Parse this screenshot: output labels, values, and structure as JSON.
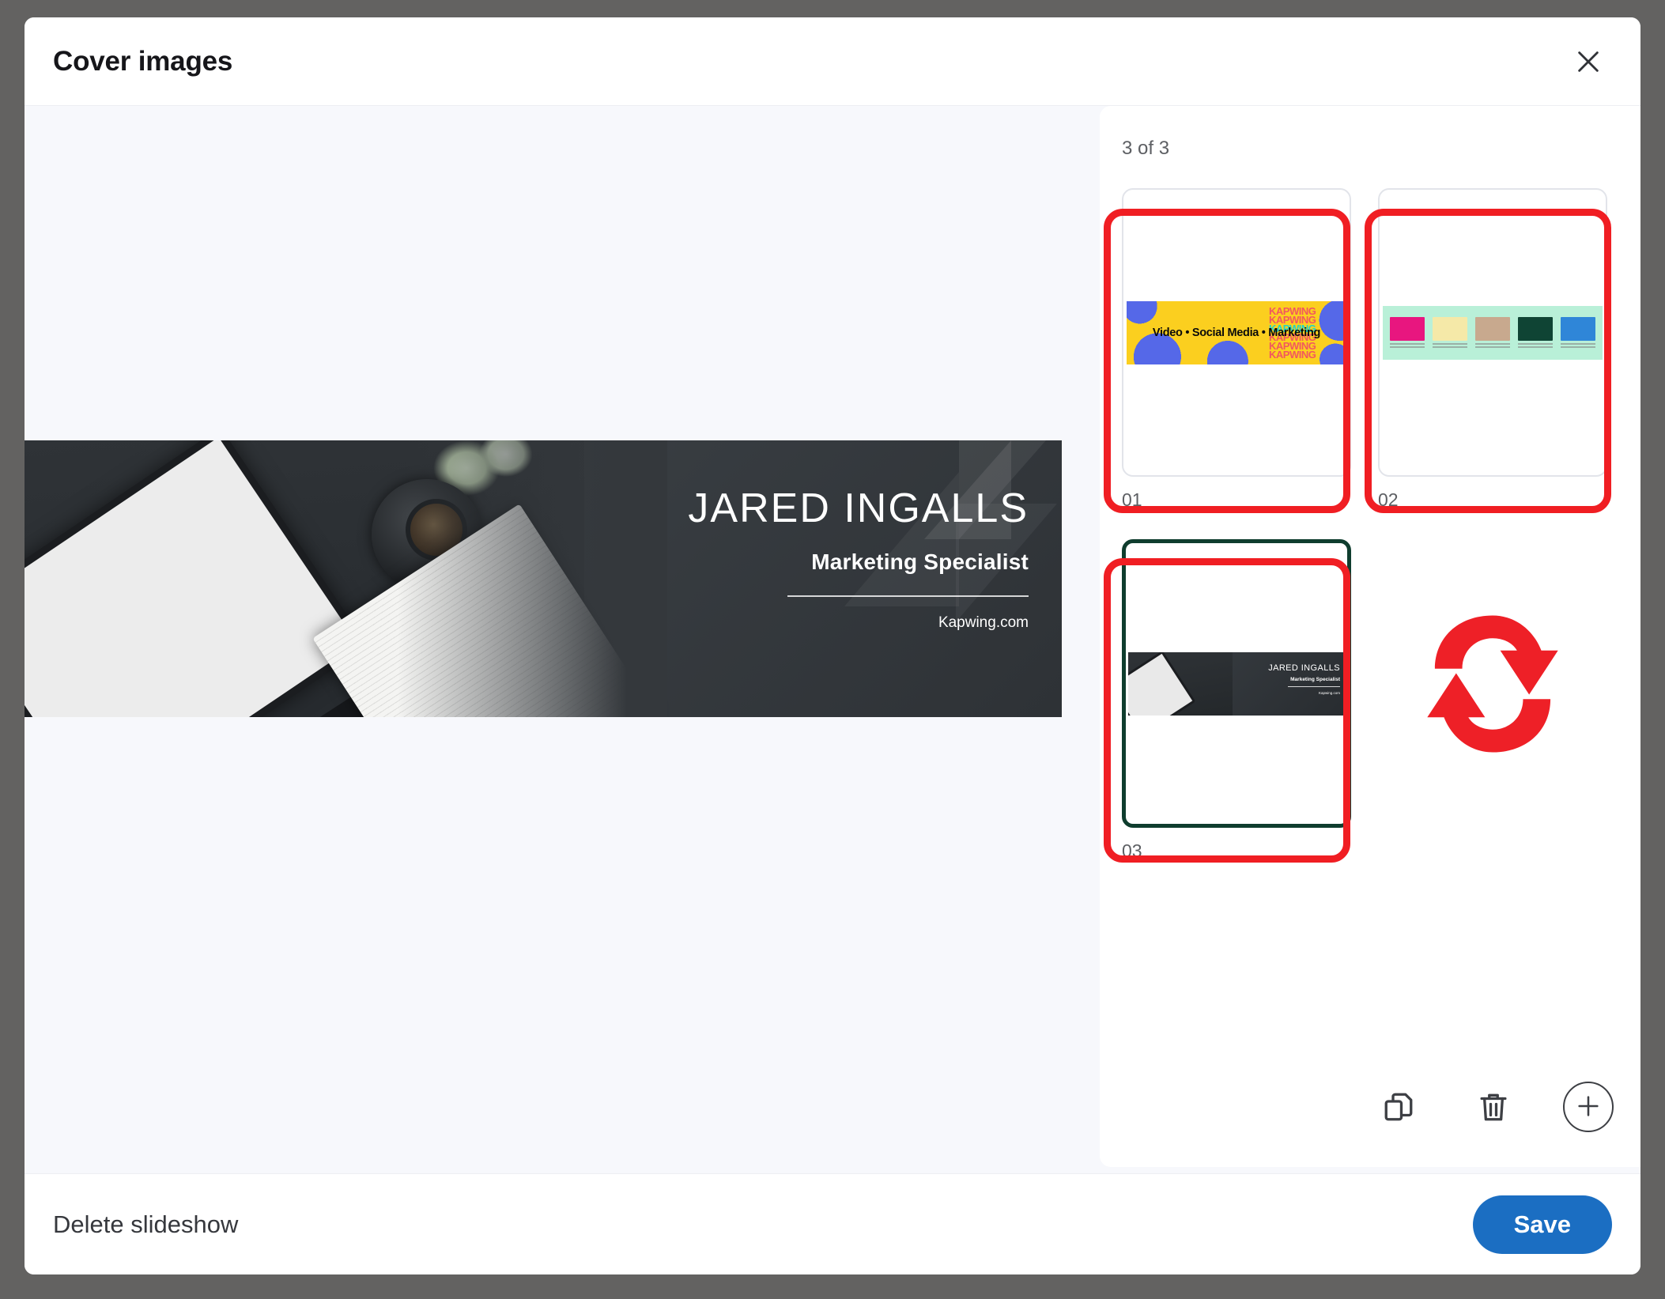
{
  "modal": {
    "title": "Cover images",
    "close_icon": "close-icon"
  },
  "preview": {
    "banner": {
      "name": "JARED INGALLS",
      "role": "Marketing Specialist",
      "website": "Kapwing.com"
    },
    "edit_annotation": {
      "icon": "pencil-icon",
      "ring_color": "#22c94f"
    }
  },
  "slides_panel": {
    "count_label": "3 of 3",
    "annotation_color": "#f01e23",
    "selected_border_color": "#0f3d2e",
    "thumbnails": [
      {
        "label": "01",
        "kind": "kapwing-yellow-banner",
        "banner_text": "Video • Social Media • Marketing",
        "brand_text": "KAPWING",
        "colors": {
          "background": "#fbcf1f",
          "accent": "#5568e8",
          "brand": "#22d3c8",
          "brand_echo": "#f2575f"
        },
        "annotated": true,
        "selected": false
      },
      {
        "label": "02",
        "kind": "mint-gallery-banner",
        "colors": {
          "background": "#b9f0d8"
        },
        "cards": [
          "#e8167f",
          "#f5e9a8",
          "#c8a98e",
          "#0f4434",
          "#2f86d8"
        ],
        "annotated": true,
        "selected": false
      },
      {
        "label": "03",
        "kind": "dark-desk-banner",
        "banner_text": "JARED INGALLS",
        "banner_subtext": "Marketing Specialist",
        "banner_site": "Kapwing.com",
        "annotated": true,
        "selected": true
      }
    ],
    "refresh_annotation": {
      "icon": "refresh-arrows-icon",
      "color": "#ee2027"
    },
    "toolbar": [
      {
        "name": "duplicate-slide-button",
        "icon": "duplicate-icon"
      },
      {
        "name": "delete-slide-button",
        "icon": "trash-icon"
      },
      {
        "name": "add-slide-button",
        "icon": "plus-icon"
      }
    ]
  },
  "footer": {
    "delete_label": "Delete slideshow",
    "save_label": "Save",
    "save_color": "#1b6ec2"
  }
}
